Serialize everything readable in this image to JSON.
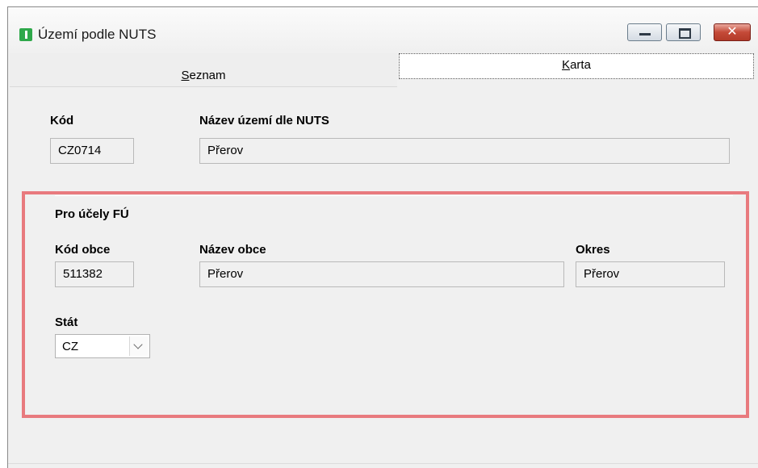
{
  "window": {
    "title": "Území podle NUTS"
  },
  "tabs": [
    {
      "label": "Seznam"
    },
    {
      "label": "Karta"
    }
  ],
  "main": {
    "kod_label": "Kód",
    "kod_value": "CZ0714",
    "nazev_label": "Název území dle NUTS",
    "nazev_value": "Přerov"
  },
  "fu_section": {
    "heading": "Pro účely FÚ",
    "kod_obce_label": "Kód obce",
    "kod_obce_value": "511382",
    "nazev_obce_label": "Název obce",
    "nazev_obce_value": "Přerov",
    "okres_label": "Okres",
    "okres_value": "Přerov",
    "stat_label": "Stát",
    "stat_value": "CZ"
  },
  "colors": {
    "highlight": "#e87a7e",
    "field_bg": "#f0f0f0",
    "window_bg": "#f0f0f0",
    "close_button": "#c44a38"
  },
  "icons": {
    "app": "app-logo-icon",
    "minimize": "minimize-icon",
    "maximize": "maximize-icon",
    "close": "close-icon",
    "dropdown": "chevron-down-icon"
  }
}
